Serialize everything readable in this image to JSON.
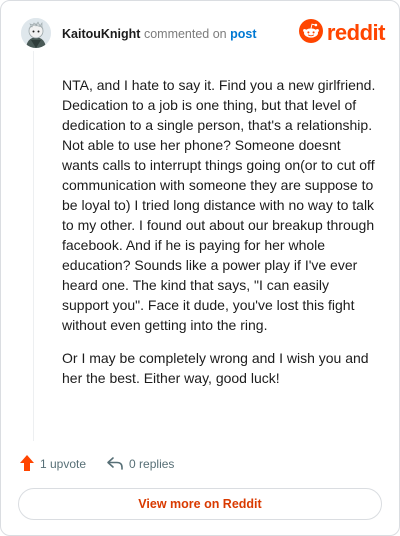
{
  "header": {
    "username": "KaitouKnight",
    "action_text": "commented on",
    "post_link": "post",
    "brand": "reddit"
  },
  "comment": {
    "paragraphs": [
      "NTA, and I hate to say it. Find you a new girlfriend. Dedication to a job is one thing, but that level of dedication to a single person, that's a relationship. Not able to use her phone? Someone doesnt wants calls to interrupt things going on(or to cut off communication with someone they are suppose to be loyal to) I tried long distance with no way to talk to my other. I found out about our breakup through facebook. And if he is paying for her whole education? Sounds like a power play if I've ever heard one. The kind that says, \"I can easily support you\". Face it dude, you've lost this fight without even getting into the ring.",
      "Or I may be completely wrong and I wish you and her the best. Either way, good luck!"
    ]
  },
  "actions": {
    "upvote_label": "1 upvote",
    "replies_label": "0 replies"
  },
  "footer": {
    "button_label": "View more on Reddit"
  },
  "colors": {
    "brand": "#ff4500",
    "link": "#0079d3",
    "button_text": "#d93a00"
  },
  "icons": [
    "avatar-snoo",
    "reddit-logo-icon",
    "upvote-arrow-icon",
    "reply-arrow-icon"
  ]
}
